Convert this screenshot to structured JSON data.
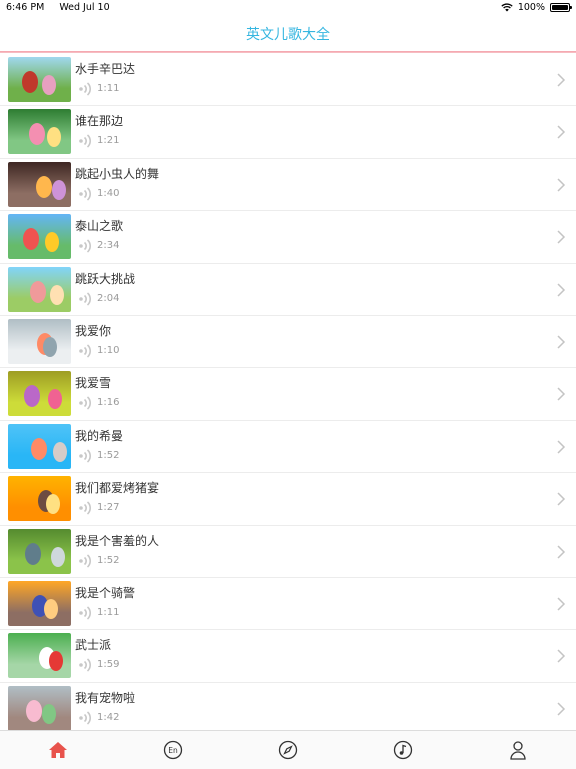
{
  "status_bar": {
    "time": "6:46 PM",
    "date": "Wed Jul 10",
    "battery": "100%"
  },
  "nav": {
    "title": "英文儿歌大全"
  },
  "songs": [
    {
      "title": "水手辛巴达",
      "duration": "1:11"
    },
    {
      "title": "谁在那边",
      "duration": "1:21"
    },
    {
      "title": "跳起小虫人的舞",
      "duration": "1:40"
    },
    {
      "title": "泰山之歌",
      "duration": "2:34"
    },
    {
      "title": "跳跃大挑战",
      "duration": "2:04"
    },
    {
      "title": "我爱你",
      "duration": "1:10"
    },
    {
      "title": "我爱雪",
      "duration": "1:16"
    },
    {
      "title": "我的希曼",
      "duration": "1:52"
    },
    {
      "title": "我们都爱烤猪宴",
      "duration": "1:27"
    },
    {
      "title": "我是个害羞的人",
      "duration": "1:52"
    },
    {
      "title": "我是个骑警",
      "duration": "1:11"
    },
    {
      "title": "武士派",
      "duration": "1:59"
    },
    {
      "title": "我有宠物啦",
      "duration": "1:42"
    }
  ],
  "tabs": [
    {
      "icon": "home-icon",
      "active": true
    },
    {
      "icon": "english-icon",
      "label": "En",
      "active": false
    },
    {
      "icon": "compass-icon",
      "active": false
    },
    {
      "icon": "music-note-icon",
      "active": false
    },
    {
      "icon": "person-icon",
      "active": false
    }
  ],
  "colors": {
    "accent": "#35b6e0",
    "active_tab": "#e8534c",
    "inactive_tab": "#333333"
  }
}
